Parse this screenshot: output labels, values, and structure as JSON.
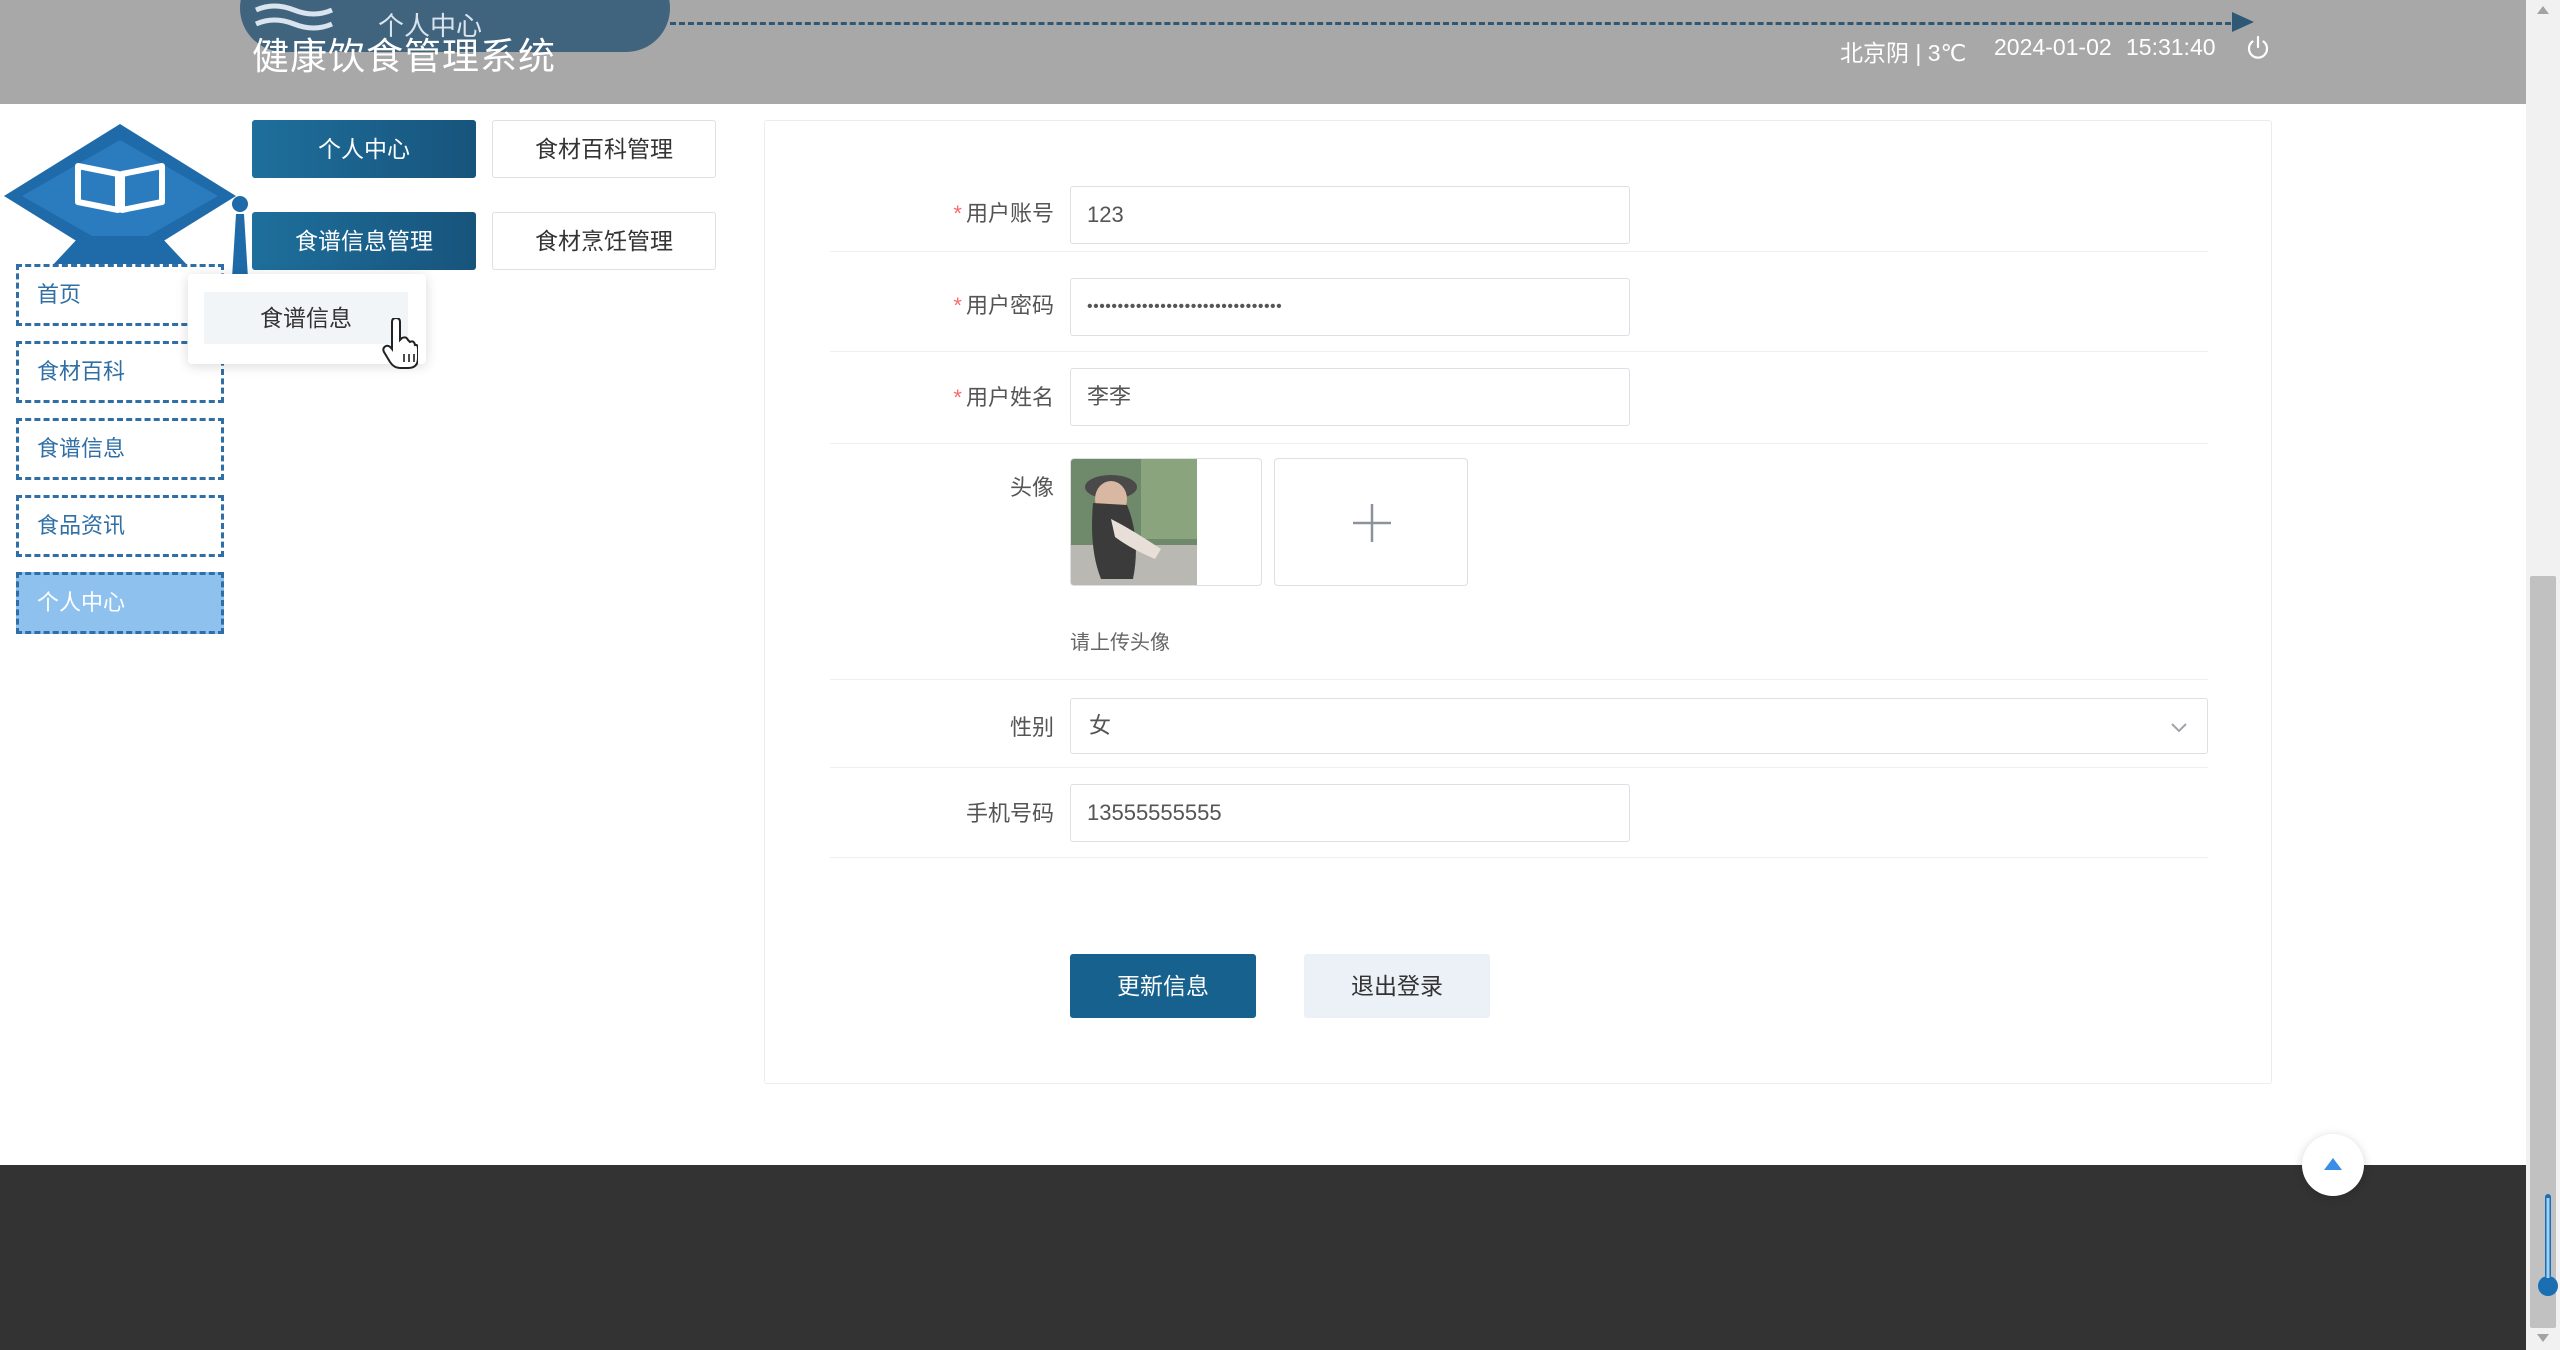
{
  "header": {
    "deco_label": "个人中心",
    "title": "健康饮食管理系统",
    "weather": "北京阴 | 3℃",
    "date": "2024-01-02",
    "time": "15:31:40",
    "power_icon": "power-icon"
  },
  "logo": {
    "icon": "book-icon"
  },
  "side_nav": {
    "items": [
      {
        "label": "首页"
      },
      {
        "label": "食材百科"
      },
      {
        "label": "食谱信息"
      },
      {
        "label": "食品资讯"
      },
      {
        "label": "个人中心",
        "active": true
      }
    ]
  },
  "top_buttons": {
    "personal_center": "个人中心",
    "ingredient_wiki_mgmt": "食材百科管理",
    "recipe_info_mgmt": "食谱信息管理",
    "ingredient_cooking_mgmt": "食材烹饪管理"
  },
  "popup": {
    "item": "食谱信息"
  },
  "form": {
    "account_label": "用户账号",
    "account_value": "123",
    "password_label": "用户密码",
    "password_value": "••••••••••••••••••••••••••••••••",
    "name_label": "用户姓名",
    "name_value": "李李",
    "avatar_label": "头像",
    "avatar_hint": "请上传头像",
    "gender_label": "性别",
    "gender_value": "女",
    "phone_label": "手机号码",
    "phone_value": "13555555555",
    "required_mark": "*",
    "update_button": "更新信息",
    "logout_button": "退出登录"
  },
  "colors": {
    "header_bg": "#a8a8a8",
    "primary": "#17618e",
    "nav_border": "#2f6fa6",
    "nav_active_bg": "#8fc1ee",
    "footer_bg": "#333333"
  }
}
